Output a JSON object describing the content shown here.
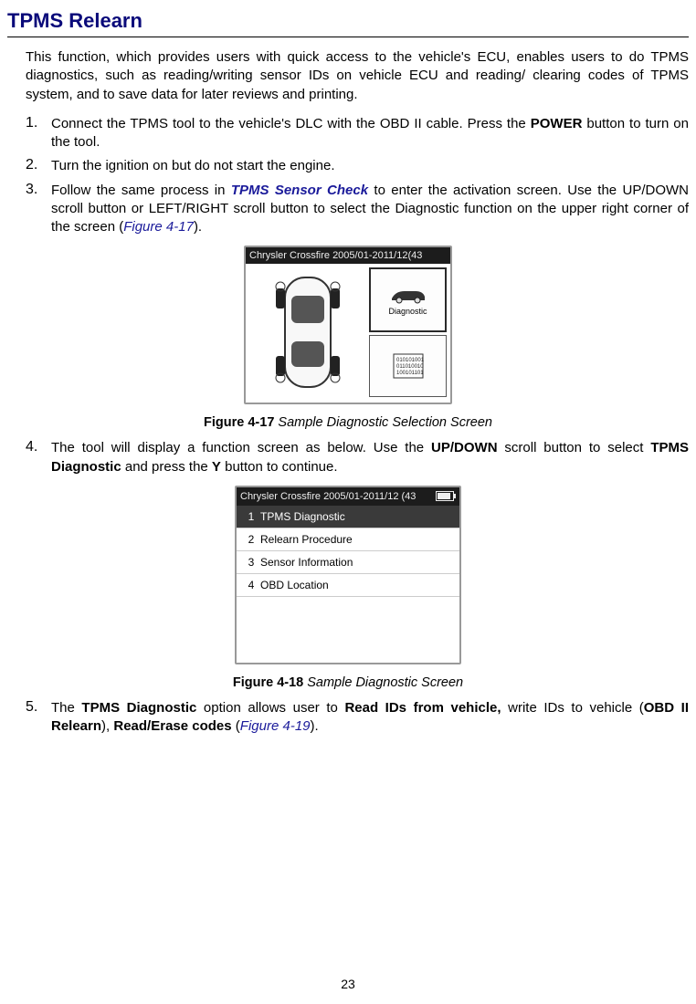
{
  "title": "TPMS Relearn",
  "intro": "This function, which provides users with quick access to the vehicle's ECU, enables users to do TPMS diagnostics, such as reading/writing sensor IDs on vehicle ECU and reading/ clearing codes of TPMS system, and to save data for later reviews and printing.",
  "steps": {
    "s1": {
      "num": "1.",
      "pre": "Connect the TPMS tool to the vehicle's DLC with the OBD II cable. Press the ",
      "b1": "POWER",
      "post": " button to turn on the tool."
    },
    "s2": {
      "num": "2.",
      "text": "Turn the ignition on but do not start the engine."
    },
    "s3": {
      "num": "3.",
      "pre": "Follow the same process in ",
      "link": "TPMS Sensor Check",
      "mid": " to enter the activation screen. Use the UP/DOWN scroll button or LEFT/RIGHT scroll button to select the Diagnostic function on the upper right corner of the screen (",
      "figref": "Figure 4-17",
      "post": ")."
    },
    "s4": {
      "num": "4.",
      "pre": "The tool will display a function screen as below. Use the ",
      "b1": "UP/DOWN",
      "mid1": " scroll button to select ",
      "b2": "TPMS Diagnostic",
      "mid2": " and press the ",
      "b3": "Y",
      "post": " button to continue."
    },
    "s5": {
      "num": "5.",
      "pre": "The ",
      "b1": "TPMS Diagnostic",
      "mid1": " option allows user to ",
      "b2": "Read IDs from vehicle,",
      "mid2": " write IDs to vehicle (",
      "b3": "OBD II Relearn",
      "mid3": "), ",
      "b4": "Read/Erase codes",
      "mid4": " (",
      "figref": "Figure 4-19",
      "post": ")."
    }
  },
  "fig1": {
    "topbar": "Chrysler Crossfire 2005/01-2011/12(43",
    "diag_label": "Diagnostic",
    "caption_bold": "Figure 4-17",
    "caption_italic": " Sample Diagnostic Selection Screen"
  },
  "fig2": {
    "topbar": "Chrysler Crossfire 2005/01-2011/12 (43",
    "rows": [
      {
        "n": "1",
        "t": "TPMS Diagnostic"
      },
      {
        "n": "2",
        "t": "Relearn Procedure"
      },
      {
        "n": "3",
        "t": "Sensor Information"
      },
      {
        "n": "4",
        "t": "OBD Location"
      }
    ],
    "caption_bold": "Figure 4-18",
    "caption_italic": " Sample Diagnostic Screen"
  },
  "page_number": "23"
}
